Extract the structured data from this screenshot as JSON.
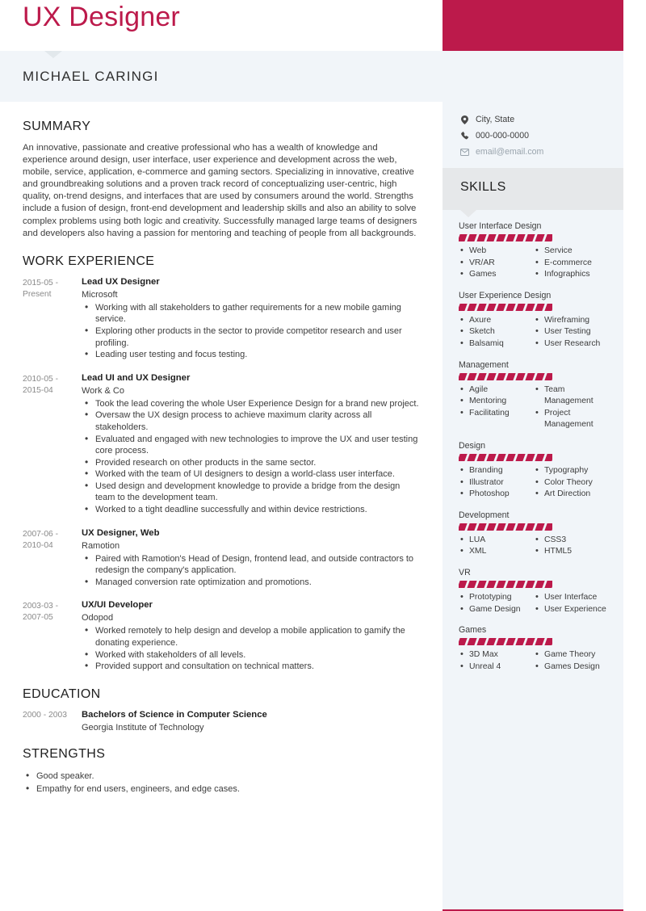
{
  "header": {
    "title": "UX Designer",
    "name": "MICHAEL CARINGI",
    "accent_color": "#bc1a4b",
    "band_color": "#f1f5f9"
  },
  "contact": {
    "location": {
      "icon": "location-pin-icon",
      "value": "City, State"
    },
    "phone": {
      "icon": "phone-icon",
      "value": "000-000-0000"
    },
    "email": {
      "icon": "envelope-icon",
      "value": "email@email.com"
    }
  },
  "summary": {
    "title": "SUMMARY",
    "text": "An innovative, passionate and creative professional who has a wealth of knowledge and experience around design, user interface, user experience and development across the web, mobile, service, application, e-commerce and gaming sectors. Specializing in innovative, creative and groundbreaking solutions and a proven track record of conceptualizing user-centric, high quality, on-trend designs, and interfaces that are used by consumers around the world.  Strengths include a fusion of design, front-end development and leadership skills and also an ability to solve complex problems using both logic and creativity. Successfully managed large teams of designers and developers also having a passion for mentoring and teaching of people from all backgrounds."
  },
  "work": {
    "title": "WORK EXPERIENCE",
    "jobs": [
      {
        "dates": "2015-05 - Present",
        "title": "Lead UX Designer",
        "org": "Microsoft",
        "bullets": [
          "Working with all stakeholders to gather requirements for a new mobile gaming service.",
          "Exploring other products in the sector to provide competitor research and user profiling.",
          "Leading user testing and focus testing."
        ]
      },
      {
        "dates": "2010-05 - 2015-04",
        "title": "Lead UI and UX Designer",
        "org": "Work & Co",
        "bullets": [
          "Took the lead covering the whole User Experience Design for a brand new project.",
          "Oversaw the UX design process to achieve maximum clarity across all stakeholders.",
          "Evaluated and engaged with new technologies to improve the UX and user testing core process.",
          "Provided research on other products in the same sector.",
          "Worked with the team of UI designers to design a world-class user interface.",
          "Used design and development knowledge to provide a bridge from the design team to the development team.",
          "Worked to a tight deadline successfully and within device restrictions."
        ]
      },
      {
        "dates": "2007-06 - 2010-04",
        "title": "UX Designer, Web",
        "org": "Ramotion",
        "bullets": [
          "Paired with Ramotion's Head of Design, frontend lead, and outside contractors to redesign the company's application.",
          "Managed conversion rate optimization and promotions."
        ]
      },
      {
        "dates": "2003-03 - 2007-05",
        "title": "UX/UI Developer",
        "org": "Odopod",
        "bullets": [
          "Worked remotely to help design and develop a mobile application to gamify the donating experience.",
          "Worked with stakeholders of all levels.",
          "Provided support and consultation on technical matters."
        ]
      }
    ]
  },
  "education": {
    "title": "EDUCATION",
    "entries": [
      {
        "dates": "2000 - 2003",
        "degree": "Bachelors of Science in Computer Science",
        "school": "Georgia Institute of Technology"
      }
    ]
  },
  "strengths": {
    "title": "STRENGTHS",
    "items": [
      "Good speaker.",
      "Empathy for end users, engineers, and edge cases."
    ]
  },
  "skills": {
    "title": "SKILLS",
    "bar_color": "#bc1a4b",
    "bar_segments": 10,
    "groups": [
      {
        "name": "User Interface Design",
        "level": 10,
        "left": [
          "Web",
          "VR/AR",
          "Games"
        ],
        "right": [
          "Service",
          "E-commerce",
          "Infographics"
        ]
      },
      {
        "name": "User Experience Design",
        "level": 10,
        "left": [
          "Axure",
          "Sketch",
          "Balsamiq"
        ],
        "right": [
          "Wireframing",
          "User Testing",
          "User Research"
        ]
      },
      {
        "name": "Management",
        "level": 10,
        "left": [
          "Agile",
          "Mentoring",
          "Facilitating"
        ],
        "right": [
          "Team Management",
          "Project Management"
        ]
      },
      {
        "name": "Design",
        "level": 10,
        "left": [
          "Branding",
          "Illustrator",
          "Photoshop"
        ],
        "right": [
          "Typography",
          "Color Theory",
          "Art Direction"
        ]
      },
      {
        "name": "Development",
        "level": 10,
        "left": [
          "LUA",
          "XML"
        ],
        "right": [
          "CSS3",
          "HTML5"
        ]
      },
      {
        "name": "VR",
        "level": 10,
        "left": [
          "Prototyping",
          "Game Design"
        ],
        "right": [
          "User Interface",
          "User Experience"
        ]
      },
      {
        "name": "Games",
        "level": 10,
        "left": [
          "3D Max",
          "Unreal 4"
        ],
        "right": [
          "Game Theory",
          "Games Design"
        ]
      }
    ]
  }
}
